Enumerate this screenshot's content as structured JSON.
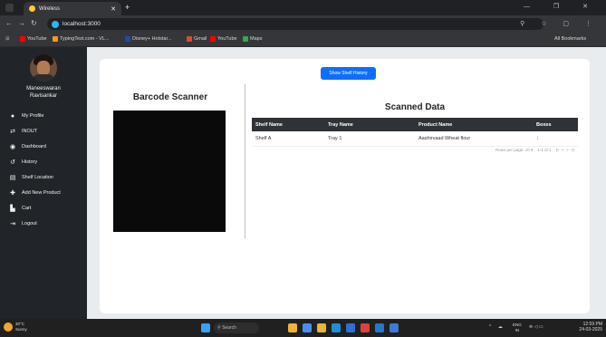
{
  "browser": {
    "tab_title": "Wireless",
    "url": "localhost:3000",
    "bookmarks": [
      "YouTube",
      "TypingTest.com - VL...",
      "Disney+ Hotstar...",
      "Gmail",
      "YouTube",
      "Maps"
    ],
    "all_bookmarks": "All Bookmarks"
  },
  "sidebar": {
    "user_name_line1": "Maneeswaran",
    "user_name_line2": "Ravisankar",
    "items": [
      {
        "label": "My Profile",
        "icon": "user-icon"
      },
      {
        "label": "INOUT",
        "icon": "swap-icon"
      },
      {
        "label": "Dashboard",
        "icon": "dashboard-icon"
      },
      {
        "label": "History",
        "icon": "history-icon"
      },
      {
        "label": "Shelf Location",
        "icon": "shelf-icon"
      },
      {
        "label": "Add New Product",
        "icon": "plus-icon"
      },
      {
        "label": "Cart",
        "icon": "cart-icon"
      },
      {
        "label": "Logout",
        "icon": "logout-icon"
      }
    ]
  },
  "main": {
    "history_button": "Show Shelf History",
    "scanner_title": "Barcode Scanner",
    "data_title": "Scanned Data",
    "table": {
      "headers": [
        "Shelf Name",
        "Tray Name",
        "Product Name",
        "Boxes"
      ],
      "rows": [
        [
          "Shelf A",
          "Tray 1",
          "Aashirvaad Wheat flour",
          "1"
        ]
      ]
    },
    "pagination": {
      "rows_per_page_label": "Rows per page:",
      "rows_per_page": "10",
      "range": "1-1 of 1"
    }
  },
  "taskbar": {
    "weather_temp": "30°C",
    "weather_desc": "Sunny",
    "search_placeholder": "Search",
    "lang": "ENG",
    "lang2": "IN",
    "time": "12:59 PM",
    "date": "24-03-2025"
  },
  "colors": {
    "sidebar_bg": "#212529",
    "primary": "#0d6efd",
    "table_header": "#2f3236",
    "page_bg": "#e9ecef"
  }
}
